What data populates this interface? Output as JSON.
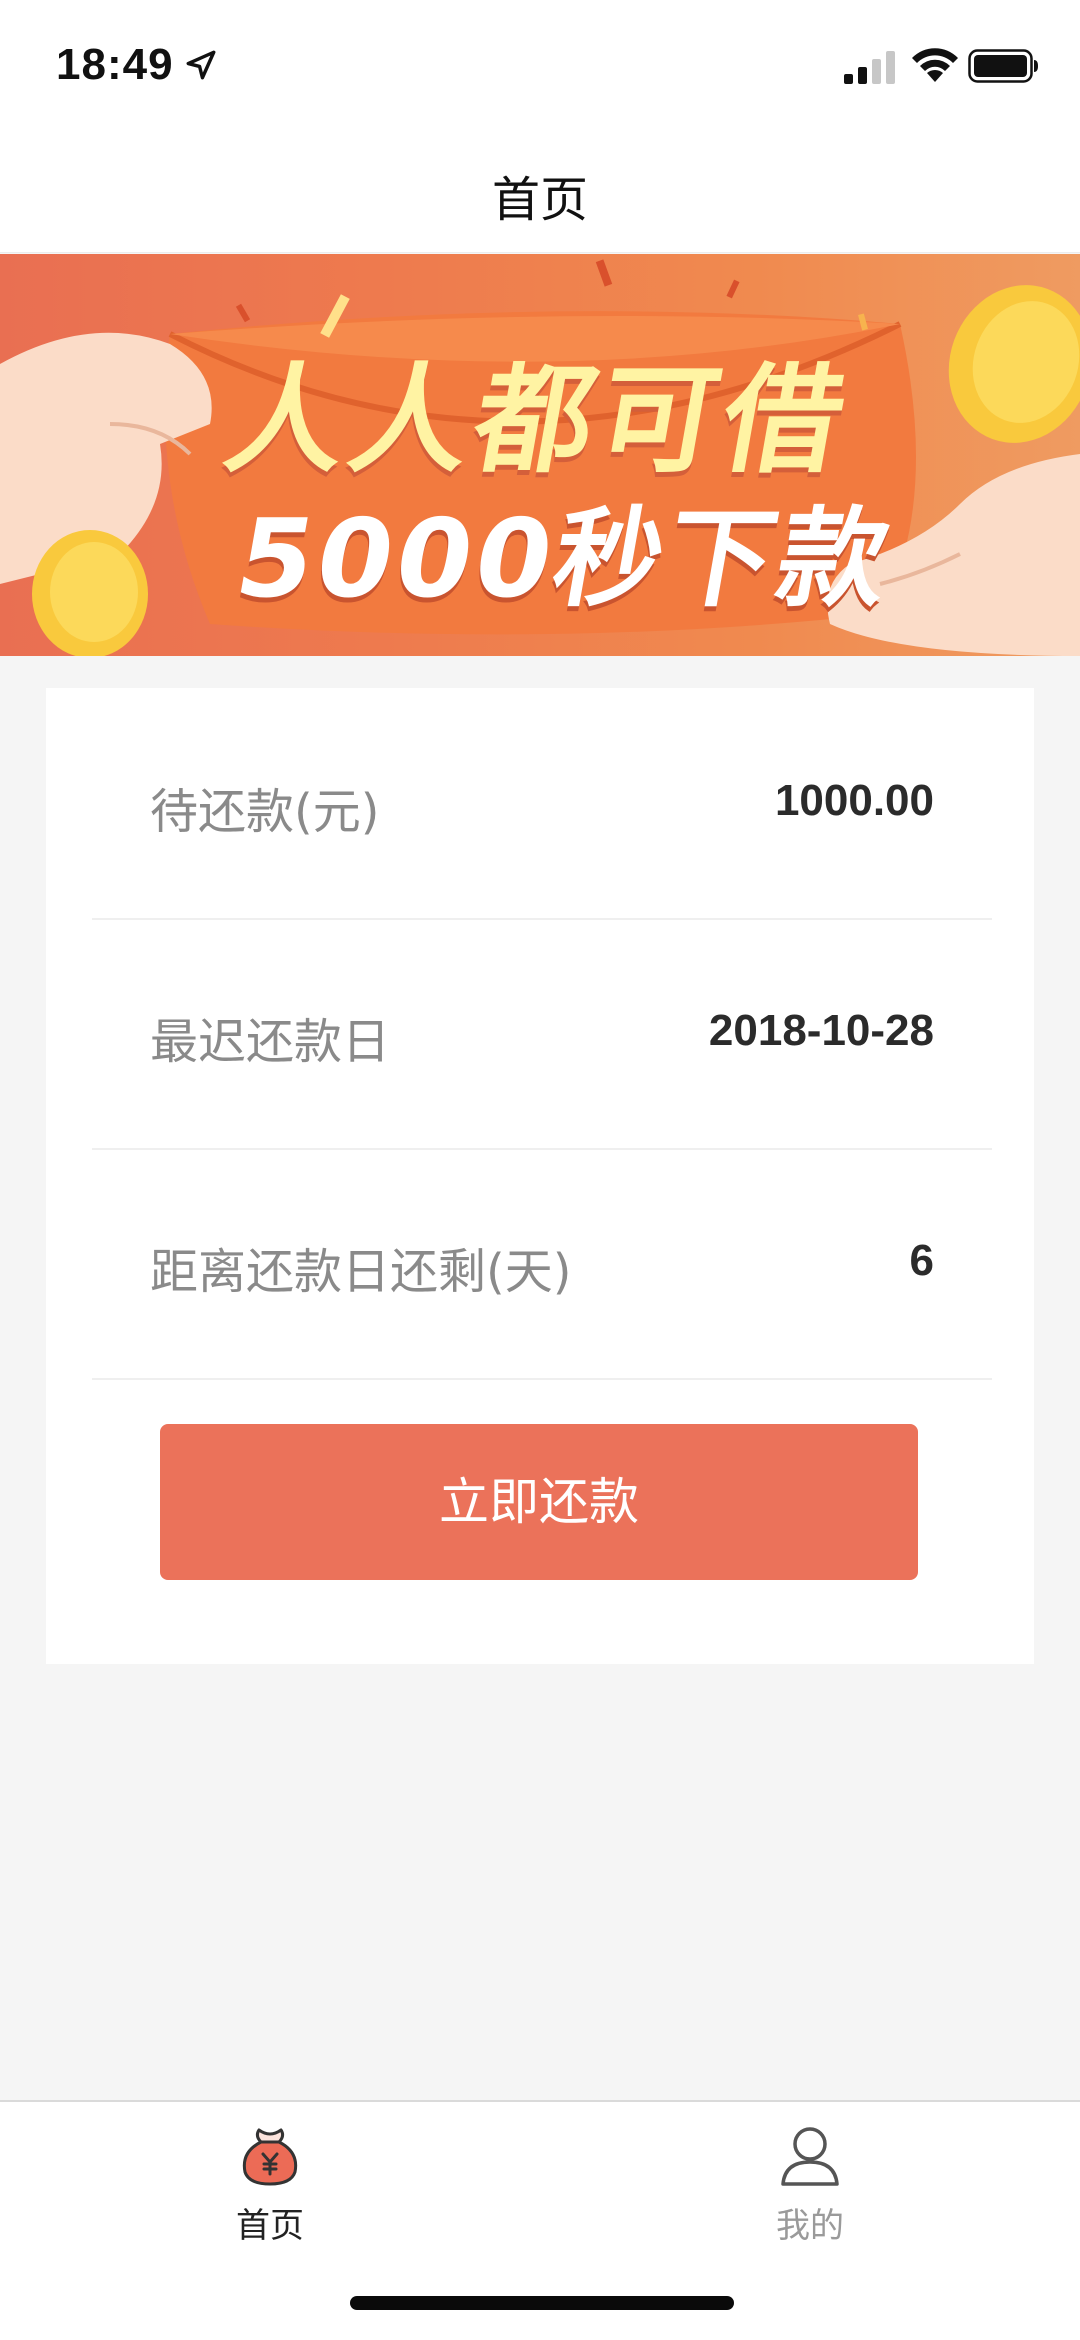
{
  "status_bar": {
    "time": "18:49"
  },
  "nav": {
    "title": "首页"
  },
  "banner": {
    "line1": "人人都可借",
    "line2": "5000秒下款"
  },
  "summary": {
    "rows": [
      {
        "label": "待还款(元)",
        "value": "1000.00"
      },
      {
        "label": "最迟还款日",
        "value": "2018-10-28"
      },
      {
        "label": "距离还款日还剩(天)",
        "value": "6"
      }
    ],
    "repay_button": "立即还款"
  },
  "tab_bar": {
    "tabs": [
      {
        "label": "首页",
        "icon": "money-bag-icon",
        "active": true
      },
      {
        "label": "我的",
        "icon": "user-icon",
        "active": false
      }
    ]
  },
  "colors": {
    "accent": "#eb725a",
    "banner_text": "#fff3a3",
    "label_text": "#8a8a8a",
    "value_text": "#2b2b2b"
  }
}
